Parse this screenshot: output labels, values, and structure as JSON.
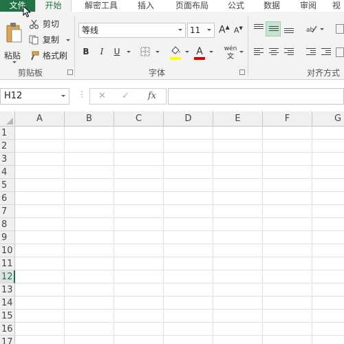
{
  "ribbon_tabs": {
    "file": "文件",
    "items": [
      "开始",
      "解密工具",
      "插入",
      "页面布局",
      "公式",
      "数据",
      "审阅",
      "视"
    ]
  },
  "clipboard": {
    "paste_label": "粘贴",
    "cut_label": "剪切",
    "copy_label": "复制",
    "format_painter_label": "格式刷",
    "group_label": "剪贴板"
  },
  "font": {
    "font_name": "等线",
    "font_size": "11",
    "grow_label": "A",
    "shrink_label": "A",
    "bold": "B",
    "italic": "I",
    "underline": "U",
    "font_color_glyph": "A",
    "phonetic": "wén",
    "group_label": "字体",
    "highlight_color": "#ffff00",
    "font_color": "#e00000"
  },
  "alignment": {
    "group_label": "对齐方式"
  },
  "formula_bar": {
    "namebox_value": "H12",
    "fx": "fx",
    "cancel": "✕",
    "enter": "✓"
  },
  "grid": {
    "columns": [
      "A",
      "B",
      "C",
      "D",
      "E",
      "F",
      "G"
    ],
    "rows": [
      "1",
      "2",
      "3",
      "4",
      "5",
      "6",
      "7",
      "8",
      "9",
      "10",
      "11",
      "12",
      "13",
      "14",
      "15",
      "16",
      "17"
    ],
    "active_row": "12"
  },
  "colors": {
    "accent": "#217346"
  }
}
